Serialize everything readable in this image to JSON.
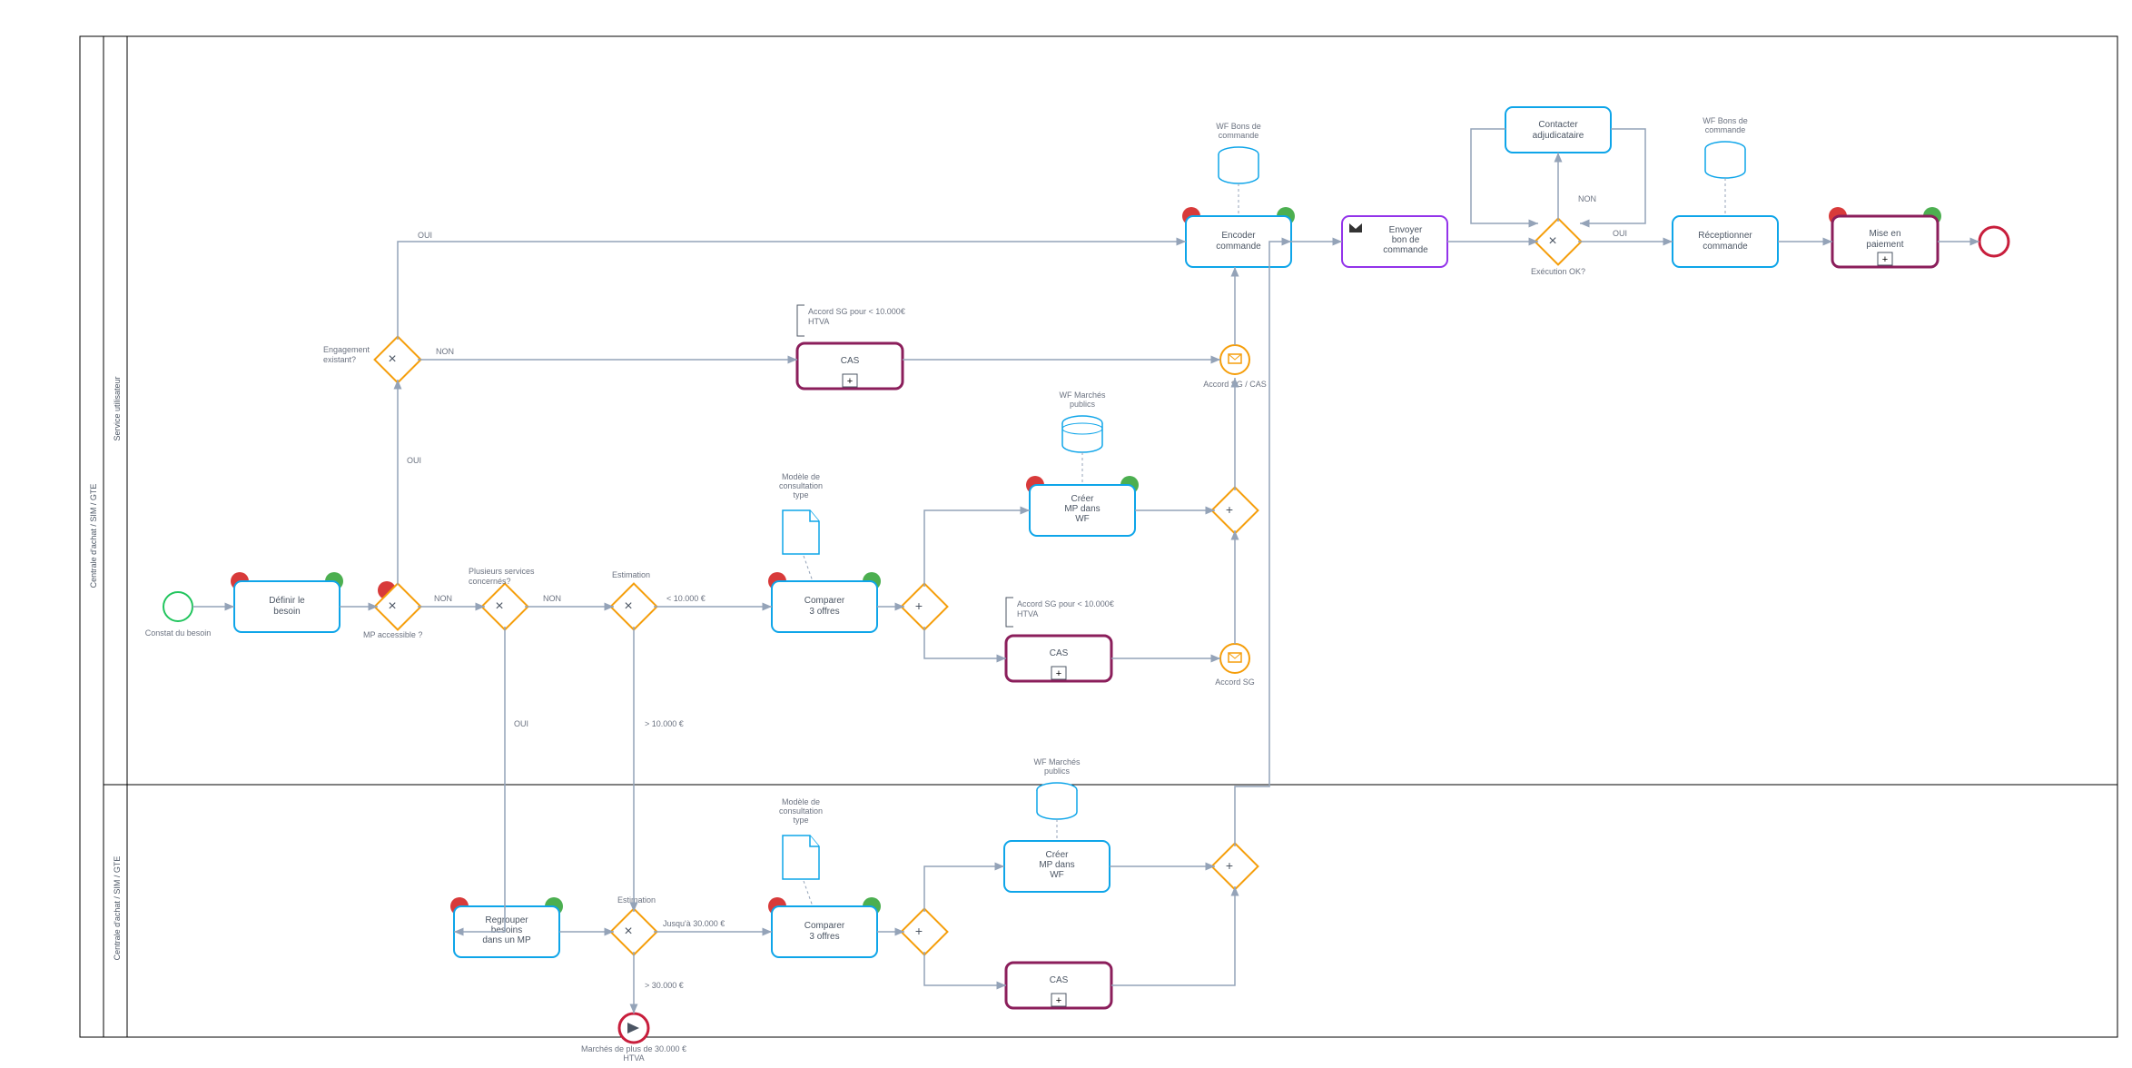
{
  "pool": "Centrale d'achat / SIM / GTE",
  "lane1": "Service utilisateur",
  "lane2": "Centrale d'achat / SIM / GTE",
  "start": "Constat du besoin",
  "t_definir": "Définir le besoin",
  "gw_mp": "MP accessible ?",
  "oui": "OUI",
  "non": "NON",
  "gw_eng": "Engagement existant?",
  "gw_services": "Plusieurs services concernés?",
  "gw_est1": "Estimation",
  "est_low": "< 10.000 €",
  "est_high": "> 10.000 €",
  "anno_sg": "Accord SG pour < 10.000€ HTVA",
  "t_cas": "CAS",
  "t_compare": "Comparer 3 offres",
  "do_modele": "Modèle de consultation type",
  "t_creer": "Créer MP dans WF",
  "ds_mp": "WF Marchés publics",
  "ev_sgcas": "Accord SG / CAS",
  "ev_sg": "Accord SG",
  "t_encode": "Encoder commande",
  "ds_bc": "WF Bons de commande",
  "t_envoyer": "Envoyer bon de commande",
  "gw_exec": "Exécution OK?",
  "t_contact": "Contacter adjudicataire",
  "t_recept": "Réceptionner commande",
  "t_mise": "Mise en paiement",
  "t_regroup": "Regrouper besoins dans un MP",
  "gw_est2": "Estimation",
  "est2_low": "Jusqu'à 30.000 €",
  "est2_high": "> 30.000 €",
  "link": "Marchés de plus de 30.000 € HTVA"
}
